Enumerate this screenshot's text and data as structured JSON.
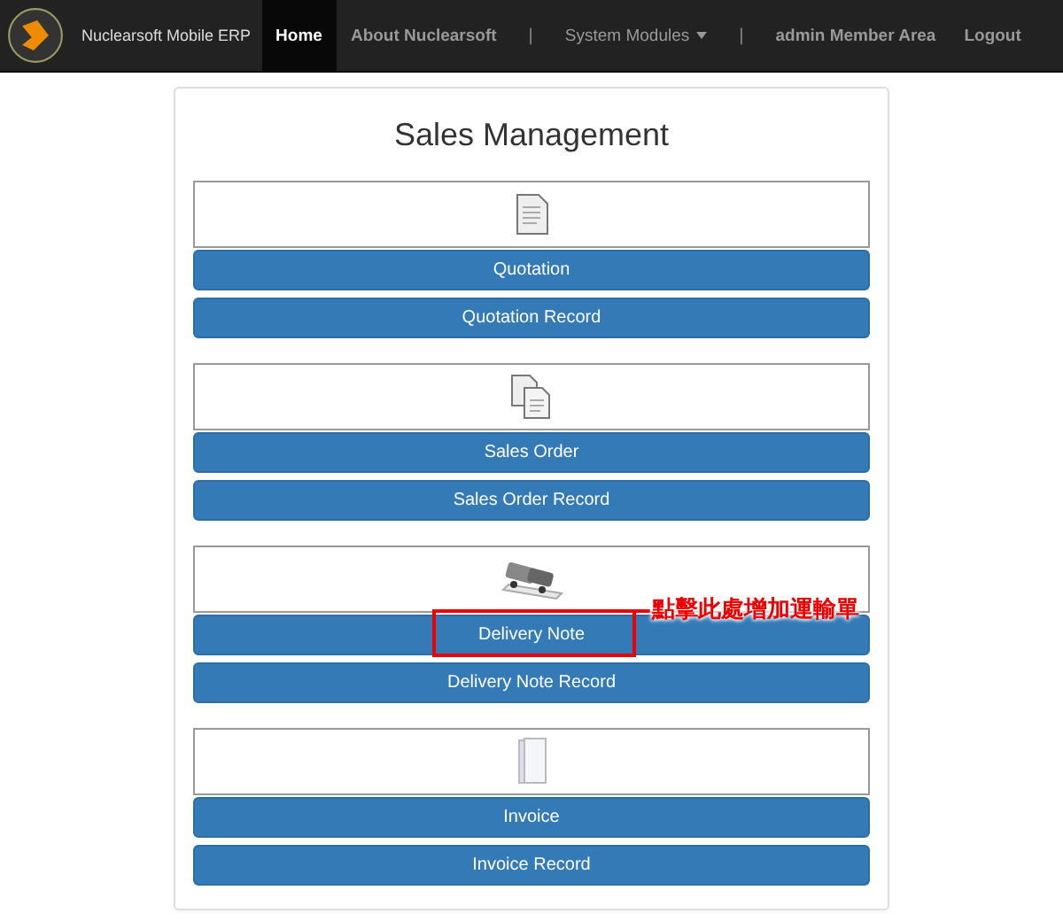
{
  "navbar": {
    "brand": "Nuclearsoft Mobile ERP",
    "items": [
      {
        "kind": "link",
        "label": "Home",
        "selected": true
      },
      {
        "kind": "link",
        "label": "About Nuclearsoft",
        "selected": false
      },
      {
        "kind": "separator",
        "label": "|"
      },
      {
        "kind": "dropdown",
        "label": "System Modules",
        "selected": false
      },
      {
        "kind": "separator",
        "label": "|"
      },
      {
        "kind": "link",
        "label": "admin Member Area",
        "selected": false
      },
      {
        "kind": "link",
        "label": "Logout",
        "selected": false
      }
    ]
  },
  "page": {
    "title": "Sales Management",
    "sections": [
      {
        "kind": "document",
        "buttons": [
          {
            "label": "Quotation",
            "highlighted": false
          },
          {
            "label": "Quotation Record",
            "highlighted": false
          }
        ]
      },
      {
        "kind": "documents",
        "buttons": [
          {
            "label": "Sales Order",
            "highlighted": false
          },
          {
            "label": "Sales Order Record",
            "highlighted": false
          }
        ]
      },
      {
        "kind": "truck",
        "buttons": [
          {
            "label": "Delivery Note",
            "highlighted": true
          },
          {
            "label": "Delivery Note Record",
            "highlighted": false
          }
        ]
      },
      {
        "kind": "folder",
        "buttons": [
          {
            "label": "Invoice",
            "highlighted": false
          },
          {
            "label": "Invoice Record",
            "highlighted": false
          }
        ]
      }
    ]
  },
  "annotation": {
    "text": "點擊此處增加運輸單"
  }
}
